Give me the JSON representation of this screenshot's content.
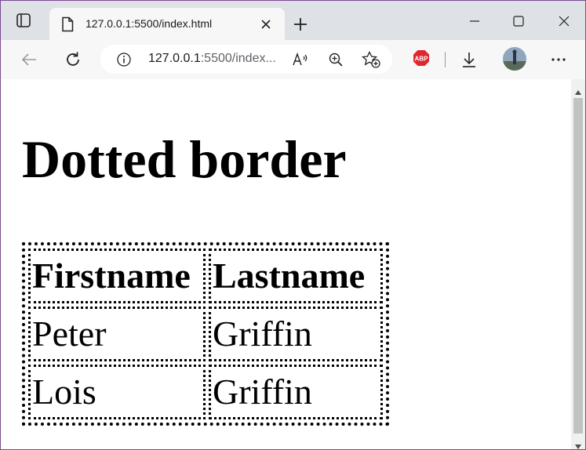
{
  "browser": {
    "tab": {
      "title": "127.0.0.1:5500/index.html"
    },
    "address_bar": {
      "host": "127.0.0.1",
      "rest": ":5500/index..."
    },
    "extensions": {
      "adblock_label": "ABP"
    },
    "colors": {
      "accent_border": "#7a4b93",
      "adblock_red": "#e0262f"
    },
    "icons": [
      "tab-actions-icon",
      "page-icon",
      "close-icon",
      "plus-icon",
      "minimize-icon",
      "maximize-icon",
      "window-close-icon",
      "back-icon",
      "refresh-icon",
      "info-icon",
      "read-aloud-icon",
      "zoom-icon",
      "add-favorite-icon",
      "adblock-icon",
      "download-icon",
      "avatar",
      "more-icon"
    ]
  },
  "page": {
    "heading": "Dotted border",
    "table": {
      "headers": [
        "Firstname",
        "Lastname"
      ],
      "rows": [
        [
          "Peter",
          "Griffin"
        ],
        [
          "Lois",
          "Griffin"
        ]
      ]
    }
  }
}
